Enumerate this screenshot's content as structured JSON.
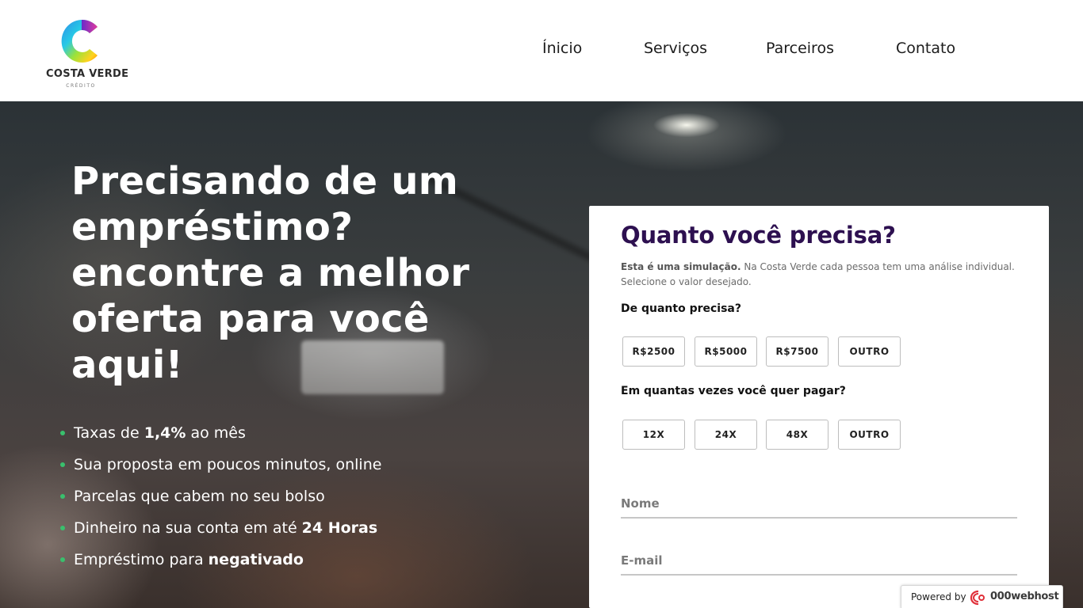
{
  "brand": {
    "name": "COSTA VERDE",
    "subtitle": "CRÉDITO"
  },
  "nav": {
    "items": [
      "Ínicio",
      "Serviços",
      "Parceiros",
      "Contato"
    ]
  },
  "hero": {
    "headline": [
      "Precisando de um",
      "empréstimo?",
      "encontre a melhor",
      "oferta para você",
      "aqui!"
    ],
    "benefits": [
      {
        "before": "Taxas de ",
        "bold": "1,4%",
        "after": " ao mês"
      },
      {
        "before": "Sua proposta em poucos minutos, online",
        "bold": "",
        "after": ""
      },
      {
        "before": "Parcelas que cabem no seu bolso",
        "bold": "",
        "after": ""
      },
      {
        "before": "Dinheiro na sua conta em até ",
        "bold": "24 Horas",
        "after": ""
      },
      {
        "before": "Empréstimo para ",
        "bold": "negativado",
        "after": ""
      }
    ]
  },
  "form": {
    "title": "Quanto você precisa?",
    "desc_bold": "Esta é uma simulação.",
    "desc_rest": " Na Costa Verde cada pessoa tem uma análise individual. Selecione o valor desejado.",
    "amount_question": "De quanto precisa?",
    "amount_options": [
      "R$2500",
      "R$5000",
      "R$7500",
      "OUTRO"
    ],
    "installments_question": "Em quantas vezes você quer pagar?",
    "installment_options": [
      "12X",
      "24X",
      "48X",
      "OUTRO"
    ],
    "name_placeholder": "Nome",
    "email_placeholder": "E-mail"
  },
  "footer_badge": {
    "prefix": "Powered by",
    "brand": "000webhost"
  },
  "colors": {
    "title_purple": "#2d1050",
    "bullet_green": "#39c06d"
  }
}
